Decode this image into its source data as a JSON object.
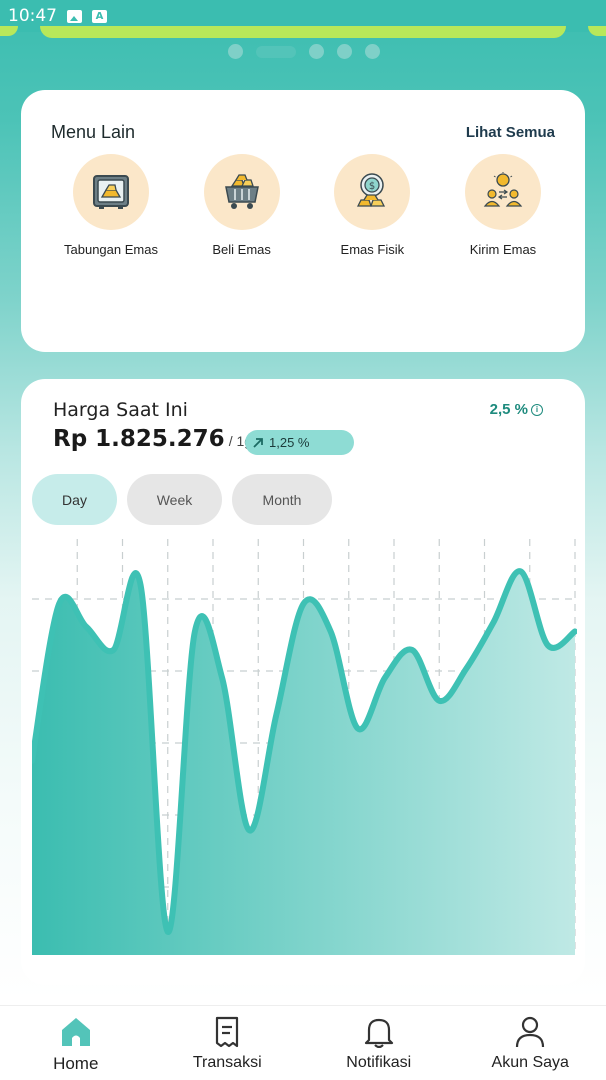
{
  "status_bar": {
    "time": "10:47"
  },
  "carousel": {
    "count": 5,
    "active_index": 1
  },
  "menu": {
    "title": "Menu Lain",
    "see_all": "Lihat Semua",
    "items": [
      {
        "label": "Tabungan Emas",
        "icon": "gold-safe-icon"
      },
      {
        "label": "Beli Emas",
        "icon": "gold-cart-icon"
      },
      {
        "label": "Emas Fisik",
        "icon": "gold-bars-coin-icon"
      },
      {
        "label": "Kirim Emas",
        "icon": "gold-transfer-icon"
      }
    ]
  },
  "price": {
    "title": "Harga Saat Ini",
    "value": "Rp 1.825.276",
    "unit": "/ 1gr",
    "change": "1,25 %",
    "percent": "2,5 %"
  },
  "tabs": [
    {
      "label": "Day",
      "active": true
    },
    {
      "label": "Week",
      "active": false
    },
    {
      "label": "Month",
      "active": false
    }
  ],
  "colors": {
    "primary": "#3bbdb0",
    "accent_line": "#3ec1b4",
    "icon_bg": "#fbe7c9",
    "gold": "#f2b92e",
    "pct_text": "#1e8b7e"
  },
  "chart_data": {
    "type": "area",
    "title": "",
    "xlabel": "",
    "ylabel": "",
    "grid": true,
    "x": [
      0,
      1,
      2,
      3,
      4,
      5,
      6,
      7,
      8,
      9,
      10,
      11,
      12,
      13,
      14,
      15,
      16,
      17,
      18,
      19,
      20
    ],
    "series": [
      {
        "values": [
          42,
          76,
          71,
          66,
          80,
          5,
          70,
          60,
          27,
          52,
          76,
          70,
          49,
          60,
          66,
          55,
          62,
          72,
          83,
          67,
          70
        ]
      }
    ],
    "ylim": [
      0,
      90
    ]
  },
  "bottom_nav": [
    {
      "label": "Home",
      "icon": "home-icon",
      "active": true
    },
    {
      "label": "Transaksi",
      "icon": "receipt-icon",
      "active": false
    },
    {
      "label": "Notifikasi",
      "icon": "bell-icon",
      "active": false
    },
    {
      "label": "Akun Saya",
      "icon": "user-icon",
      "active": false
    }
  ]
}
